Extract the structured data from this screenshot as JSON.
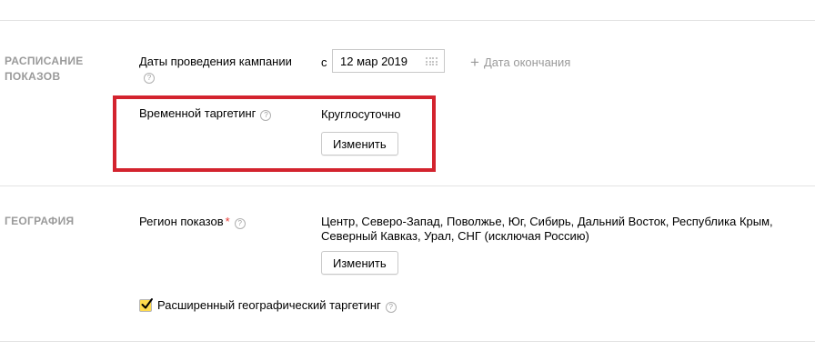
{
  "sections": {
    "schedule": {
      "title": "Расписание\nпоказов",
      "dates": {
        "label": "Даты проведения кампании",
        "from_prefix": "с",
        "start_date": "12 мар 2019",
        "add_end_date": "Дата окончания"
      },
      "time_targeting": {
        "label": "Временной таргетинг",
        "value": "Круглосуточно",
        "change_button": "Изменить"
      }
    },
    "geography": {
      "title": "География",
      "regions": {
        "label": "Регион показов",
        "required_mark": "*",
        "value_line1": "Центр, Северо-Запад, Поволжье, Юг, Сибирь, Дальний Восток, Республика Крым,",
        "value_line2": "Северный Кавказ, Урал, СНГ (исключая Россию)",
        "change_button": "Изменить"
      },
      "extended_geo": {
        "label": "Расширенный географический таргетинг",
        "checked": true
      }
    }
  },
  "help_glyph": "?",
  "plus_glyph": "+",
  "colors": {
    "highlight_border": "#d3232e",
    "checkbox_fill": "#ffdb4d",
    "section_title": "#9a9a9a",
    "required": "#e53935"
  }
}
